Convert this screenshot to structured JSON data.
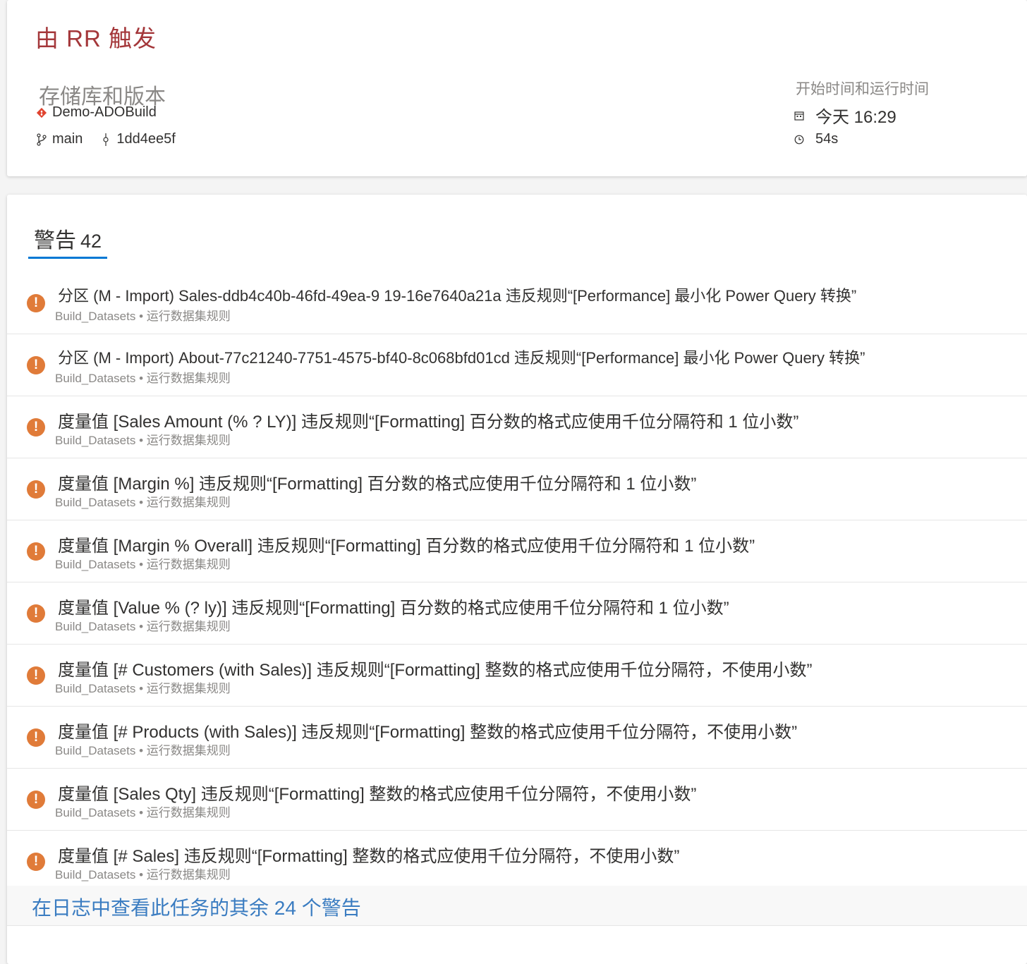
{
  "summary": {
    "trigger_title": "由 RR 触发",
    "repo_section_label": "存储库和版本",
    "repo_name": "Demo-ADOBuild",
    "branch": "main",
    "commit": "1dd4ee5f",
    "time_section_label": "开始时间和运行时间",
    "start_time": "今天 16:29",
    "duration": "54s",
    "icons": {
      "repo": "git-repo-icon",
      "branch": "branch-icon",
      "commit": "commit-icon",
      "calendar": "calendar-icon",
      "clock": "clock-icon"
    },
    "colors": {
      "trigger": "#a4373a",
      "repo_icon": "#e0432f"
    }
  },
  "warnings": {
    "tab_label": "警告",
    "tab_count": "42",
    "items": [
      {
        "text": "分区 (M - Import) Sales-ddb4c40b-46fd-49ea-9 19-16e7640a21a 违反规则“[Performance] 最小化 Power Query 转换”",
        "meta": "Build_Datasets • 运行数据集规则"
      },
      {
        "text": "分区 (M - Import) About-77c21240-7751-4575-bf40-8c068bfd01cd 违反规则“[Performance] 最小化 Power Query 转换”",
        "meta": "Build_Datasets • 运行数据集规则"
      },
      {
        "text": "度量值 [Sales Amount (% ? LY)] 违反规则“[Formatting] 百分数的格式应使用千位分隔符和 1 位小数”",
        "meta": "Build_Datasets • 运行数据集规则"
      },
      {
        "text": "度量值 [Margin %] 违反规则“[Formatting] 百分数的格式应使用千位分隔符和 1 位小数”",
        "meta": "Build_Datasets • 运行数据集规则"
      },
      {
        "text": "度量值 [Margin % Overall] 违反规则“[Formatting] 百分数的格式应使用千位分隔符和 1 位小数”",
        "meta": "Build_Datasets • 运行数据集规则"
      },
      {
        "text": "度量值 [Value % (? ly)] 违反规则“[Formatting] 百分数的格式应使用千位分隔符和 1 位小数”",
        "meta": "Build_Datasets • 运行数据集规则"
      },
      {
        "text": "度量值 [# Customers (with Sales)] 违反规则“[Formatting] 整数的格式应使用千位分隔符，不使用小数”",
        "meta": "Build_Datasets • 运行数据集规则"
      },
      {
        "text": "度量值 [# Products (with Sales)] 违反规则“[Formatting] 整数的格式应使用千位分隔符，不使用小数”",
        "meta": "Build_Datasets • 运行数据集规则"
      },
      {
        "text": "度量值 [Sales Qty] 违反规则“[Formatting] 整数的格式应使用千位分隔符，不使用小数”",
        "meta": "Build_Datasets • 运行数据集规则"
      },
      {
        "text": "度量值 [# Sales] 违反规则“[Formatting] 整数的格式应使用千位分隔符，不使用小数”",
        "meta": "Build_Datasets • 运行数据集规则"
      }
    ],
    "warning_icon_color": "#e07b39",
    "more_link": "在日志中查看此任务的其余 24 个警告"
  }
}
